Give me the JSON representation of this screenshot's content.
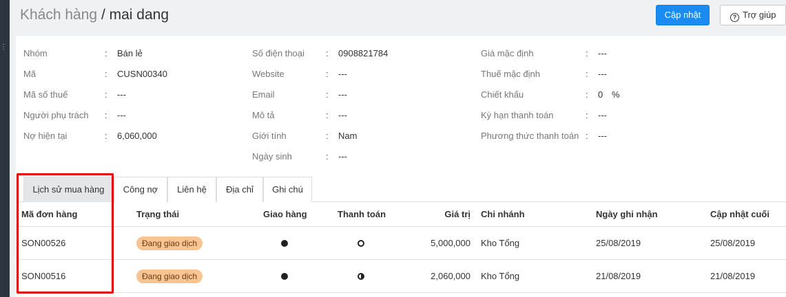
{
  "header": {
    "breadcrumb": "Khách hàng",
    "separator": " / ",
    "customer_name": "mai dang",
    "update_button": "Cập nhật",
    "help_button": "Trợ giúp"
  },
  "info": {
    "col1": [
      {
        "label": "Nhóm",
        "value": "Bán lẻ"
      },
      {
        "label": "Mã",
        "value": "CUSN00340"
      },
      {
        "label": "Mã số thuế",
        "value": "---"
      },
      {
        "label": "Người phụ trách",
        "value": "---"
      },
      {
        "label": "Nợ hiện tại",
        "value": "6,060,000"
      }
    ],
    "col2": [
      {
        "label": "Số điện thoại",
        "value": "0908821784"
      },
      {
        "label": "Website",
        "value": "---"
      },
      {
        "label": "Email",
        "value": "---"
      },
      {
        "label": "Mô tả",
        "value": "---"
      },
      {
        "label": "Giới tính",
        "value": "Nam"
      },
      {
        "label": "Ngày sinh",
        "value": "---"
      }
    ],
    "col3": [
      {
        "label": "Giá mặc định",
        "value": "---"
      },
      {
        "label": "Thuế mặc định",
        "value": "---"
      },
      {
        "label": "Chiết khấu",
        "value": "0",
        "unit": "%"
      },
      {
        "label": "Kỳ hạn thanh toán",
        "value": "---"
      },
      {
        "label": "Phương thức thanh toán",
        "value": "---"
      }
    ],
    "colon": ":"
  },
  "tabs": [
    "Lịch sử mua hàng",
    "Công nợ",
    "Liên hệ",
    "Địa chỉ",
    "Ghi chú"
  ],
  "active_tab": "Lịch sử mua hàng",
  "table": {
    "headers": [
      "Mã đơn hàng",
      "Trạng thái",
      "Giao hàng",
      "Thanh toán",
      "Giá trị",
      "Chi nhánh",
      "Ngày ghi nhận",
      "Cập nhật cuối"
    ],
    "rows": [
      {
        "code": "SON00526",
        "status": "Đang giao dịch",
        "delivery": "full",
        "payment": "empty",
        "value": "5,000,000",
        "branch": "Kho Tổng",
        "recorded": "25/08/2019",
        "updated": "25/08/2019"
      },
      {
        "code": "SON00516",
        "status": "Đang giao dịch",
        "delivery": "full",
        "payment": "half",
        "value": "2,060,000",
        "branch": "Kho Tổng",
        "recorded": "21/08/2019",
        "updated": "21/08/2019"
      }
    ]
  },
  "colors": {
    "primary": "#1a8bf0",
    "badge_bg": "#f8c592",
    "highlight": "#e00000"
  }
}
